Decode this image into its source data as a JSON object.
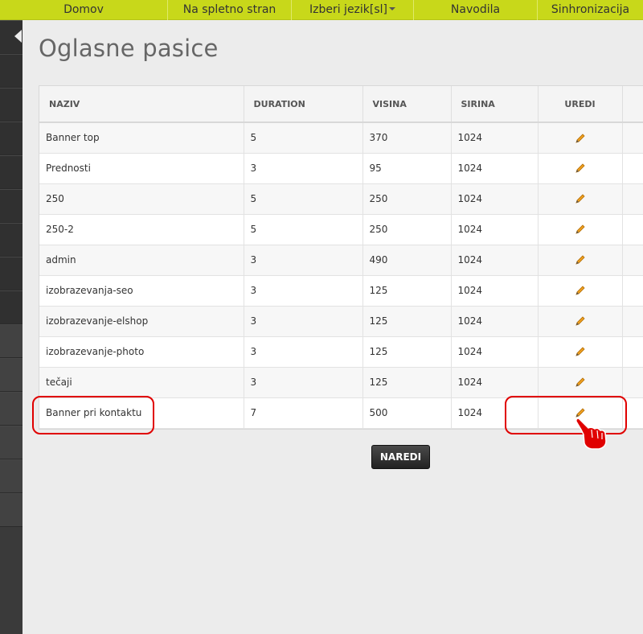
{
  "nav": {
    "items": [
      {
        "label": "Domov"
      },
      {
        "label": "Na spletno stran"
      },
      {
        "label": "Izberi jezik[sl]"
      },
      {
        "label": "Navodila"
      },
      {
        "label": "Sinhronizacija"
      }
    ]
  },
  "page": {
    "title": "Oglasne pasice"
  },
  "table": {
    "headers": {
      "naziv": "NAZIV",
      "duration": "DURATION",
      "visina": "VISINA",
      "sirina": "SIRINA",
      "uredi": "UREDI"
    },
    "rows": [
      {
        "naziv": "Banner top",
        "duration": "5",
        "visina": "370",
        "sirina": "1024"
      },
      {
        "naziv": "Prednosti",
        "duration": "3",
        "visina": "95",
        "sirina": "1024"
      },
      {
        "naziv": "250",
        "duration": "5",
        "visina": "250",
        "sirina": "1024"
      },
      {
        "naziv": "250-2",
        "duration": "5",
        "visina": "250",
        "sirina": "1024"
      },
      {
        "naziv": "admin",
        "duration": "3",
        "visina": "490",
        "sirina": "1024"
      },
      {
        "naziv": "izobrazevanja-seo",
        "duration": "3",
        "visina": "125",
        "sirina": "1024"
      },
      {
        "naziv": "izobrazevanje-elshop",
        "duration": "3",
        "visina": "125",
        "sirina": "1024"
      },
      {
        "naziv": "izobrazevanje-photo",
        "duration": "3",
        "visina": "125",
        "sirina": "1024"
      },
      {
        "naziv": "tečaji",
        "duration": "3",
        "visina": "125",
        "sirina": "1024"
      },
      {
        "naziv": "Banner pri kontaktu",
        "duration": "7",
        "visina": "500",
        "sirina": "1024"
      }
    ]
  },
  "actions": {
    "naredi_label": "NAREDI"
  },
  "colors": {
    "nav_bg": "#c8d81a",
    "sidebar_bg": "#3a3a3a",
    "highlight": "#e00000",
    "pencil": "#f0a020"
  },
  "icons": {
    "edit": "pencil-icon",
    "pointer": "pointing-hand-icon",
    "dropdown": "caret-down-icon",
    "sidebar_toggle": "chevron-left-icon"
  }
}
